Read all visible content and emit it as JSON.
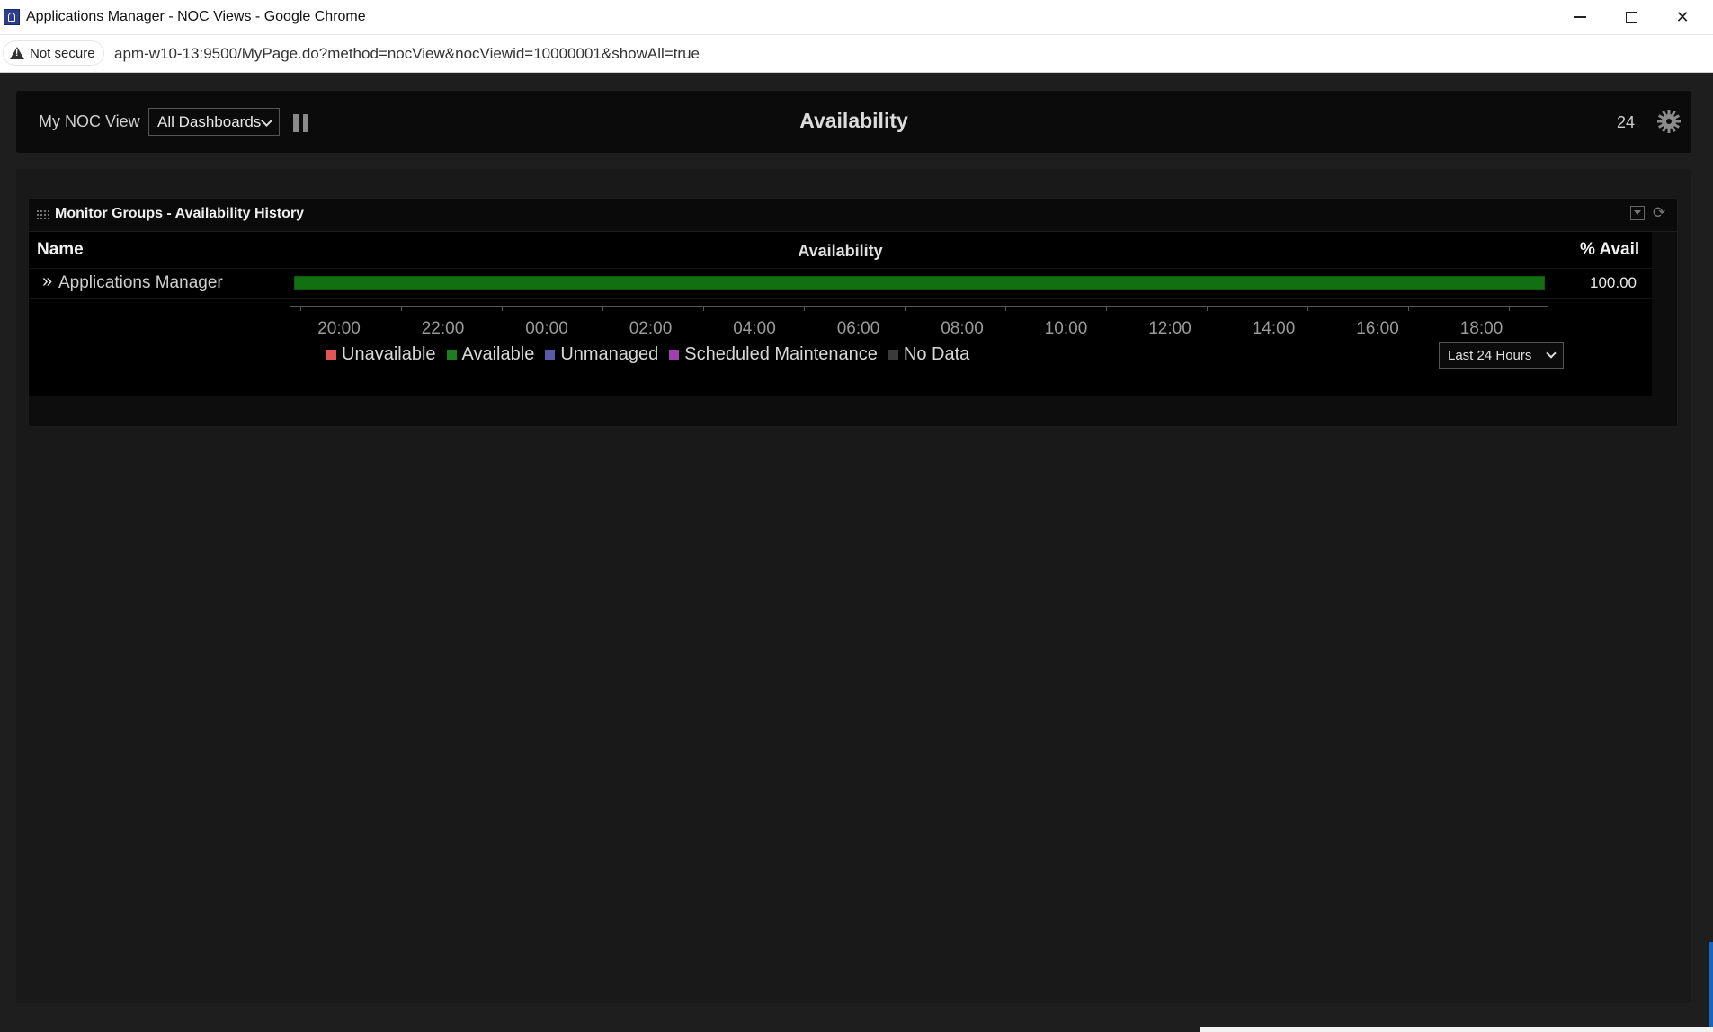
{
  "window": {
    "title": "Applications Manager - NOC Views - Google Chrome",
    "minimize_label": "",
    "close_label": "✕"
  },
  "addressbar": {
    "security_label": "Not secure",
    "url": "apm-w10-13:9500/MyPage.do?method=nocView&nocViewid=10000001&showAll=true"
  },
  "topbar": {
    "view_label": "My NOC View",
    "dashboard_select": "All Dashboards",
    "title": "Availability",
    "refresh_count": "24"
  },
  "widget": {
    "title": "Monitor Groups - Availability History",
    "columns": {
      "name": "Name",
      "availability": "Availability",
      "pct": "% Avail"
    },
    "rows": [
      {
        "arrow": "»",
        "name": "Applications Manager",
        "pct_avail": "100.00",
        "available_fraction": 1.0
      }
    ],
    "time_range_select": "Last 24 Hours"
  },
  "chart_data": {
    "type": "bar",
    "categories": [
      "Applications Manager"
    ],
    "x_ticks": [
      "20:00",
      "22:00",
      "00:00",
      "02:00",
      "04:00",
      "06:00",
      "08:00",
      "10:00",
      "12:00",
      "14:00",
      "16:00",
      "18:00"
    ],
    "series": [
      {
        "name": "Available",
        "values": [
          100.0
        ]
      }
    ],
    "legend": [
      {
        "name": "Unavailable",
        "color": "#e05555"
      },
      {
        "name": "Available",
        "color": "#1e7d1e"
      },
      {
        "name": "Unmanaged",
        "color": "#5a5aa8"
      },
      {
        "name": "Scheduled Maintenance",
        "color": "#a040b0"
      },
      {
        "name": "No Data",
        "color": "#3a3a3a"
      }
    ],
    "legend_position": "bottom"
  }
}
